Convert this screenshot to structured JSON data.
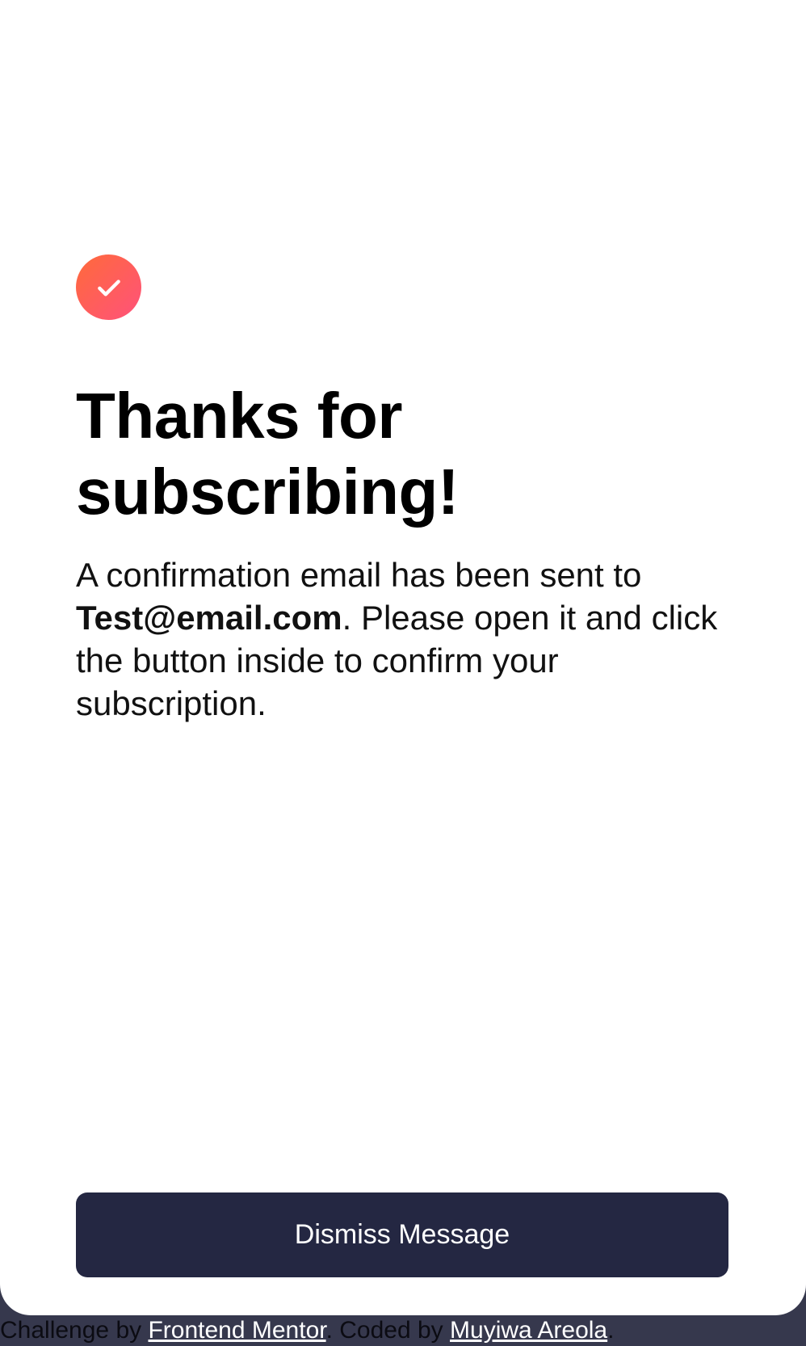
{
  "confirmation": {
    "title_line1": "Thanks for",
    "title_line2": "subscribing!",
    "message_before": "A confirmation email has been sent to ",
    "email": "Test@email.com",
    "message_after": ". Please open it and click the button inside to confirm your subscription.",
    "dismiss_label": "Dismiss Message"
  },
  "attribution": {
    "challenge_prefix": "Challenge by ",
    "challenge_link": "Frontend Mentor",
    "coded_prefix": ". Coded by ",
    "author_link": "Muyiwa Areola",
    "suffix": "."
  },
  "icons": {
    "success": "checkmark-icon"
  },
  "colors": {
    "accent_start": "#ff6a3a",
    "accent_end": "#ff527b",
    "button_bg": "#242742",
    "page_bg": "#36384d"
  }
}
